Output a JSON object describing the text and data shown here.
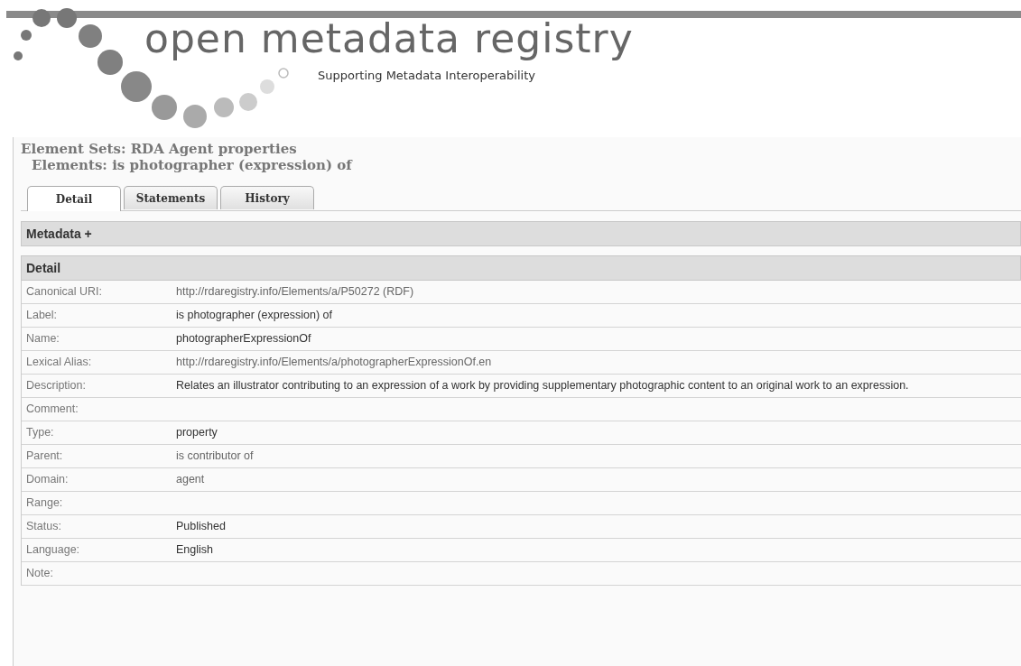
{
  "site": {
    "title": "open metadata registry",
    "tagline": "Supporting Metadata Interoperability"
  },
  "heading": {
    "element_set": "Element Sets: RDA Agent properties",
    "element": "Elements:  is photographer (expression) of"
  },
  "tabs": [
    {
      "label": "Detail",
      "selected": true
    },
    {
      "label": "Statements",
      "selected": false
    },
    {
      "label": "History",
      "selected": false
    }
  ],
  "sections": [
    {
      "title": "Metadata +"
    },
    {
      "title": "Detail"
    }
  ],
  "rows": [
    {
      "label": "Canonical URI:",
      "value": "http://rdaregistry.info/Elements/a/P50272 (RDF)",
      "kind": "link"
    },
    {
      "label": "Label:",
      "value": "is photographer (expression) of",
      "kind": "text"
    },
    {
      "label": "Name:",
      "value": "photographerExpressionOf",
      "kind": "text"
    },
    {
      "label": "Lexical Alias:",
      "value": "http://rdaregistry.info/Elements/a/photographerExpressionOf.en",
      "kind": "link"
    },
    {
      "label": "Description:",
      "value": "Relates an illustrator contributing to an expression of a work by providing supplementary photographic content to an original work to an expression.",
      "kind": "text"
    },
    {
      "label": "Comment:"
    },
    {
      "label": "Type:",
      "value": "property",
      "kind": "text"
    },
    {
      "label": "Parent:",
      "value": "is contributor of",
      "kind": "link"
    },
    {
      "label": "Domain:",
      "value": "agent",
      "kind": "link"
    },
    {
      "label": "Range:"
    },
    {
      "label": "Status:",
      "value": "Published",
      "kind": "text"
    },
    {
      "label": "Language:",
      "value": "English",
      "kind": "text"
    },
    {
      "label": "Note:"
    }
  ]
}
